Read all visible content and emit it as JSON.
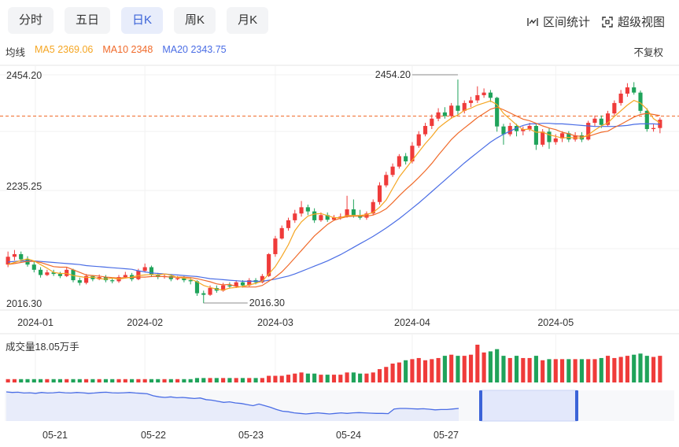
{
  "tabs": [
    {
      "label": "分时",
      "active": false
    },
    {
      "label": "五日",
      "active": false
    },
    {
      "label": "日K",
      "active": true
    },
    {
      "label": "周K",
      "active": false
    },
    {
      "label": "月K",
      "active": false
    }
  ],
  "tools": {
    "interval_stats": "区间统计",
    "super_view": "超级视图"
  },
  "legend": {
    "label": "均线",
    "ma5": "MA5 2369.06",
    "ma10": "MA10 2348",
    "ma20": "MA20 2343.75"
  },
  "rights_label": "不复权",
  "colors": {
    "up": "#ef3b3a",
    "down": "#1fa35a",
    "ma5": "#f5a623",
    "ma10": "#f06a2a",
    "ma20": "#4a6de5",
    "dashed": "#f06a2a",
    "nav_fill": "#e3e8fb",
    "nav_handle": "#3b63d8"
  },
  "chart_data": {
    "type": "candlestick",
    "y_ticks": [
      "2454.20",
      "2235.25",
      "2016.30"
    ],
    "ylim": [
      2016.3,
      2454.2
    ],
    "high_label": "2454.20",
    "low_label": "2016.30",
    "reference_line": 2375,
    "x_ticks": [
      "2024-01",
      "2024-02",
      "2024-03",
      "2024-04",
      "2024-05"
    ],
    "candles": [
      [
        2090,
        2105,
        2115,
        2085
      ],
      [
        2105,
        2110,
        2118,
        2098
      ],
      [
        2110,
        2100,
        2115,
        2095
      ],
      [
        2100,
        2090,
        2106,
        2086
      ],
      [
        2090,
        2080,
        2096,
        2075
      ],
      [
        2080,
        2070,
        2085,
        2065
      ],
      [
        2070,
        2075,
        2080,
        2068
      ],
      [
        2075,
        2072,
        2080,
        2068
      ],
      [
        2072,
        2068,
        2076,
        2064
      ],
      [
        2068,
        2080,
        2085,
        2066
      ],
      [
        2080,
        2060,
        2082,
        2056
      ],
      [
        2060,
        2055,
        2065,
        2050
      ],
      [
        2055,
        2068,
        2072,
        2052
      ],
      [
        2068,
        2062,
        2070,
        2058
      ],
      [
        2062,
        2066,
        2071,
        2060
      ],
      [
        2066,
        2060,
        2070,
        2056
      ],
      [
        2060,
        2058,
        2065,
        2054
      ],
      [
        2058,
        2066,
        2070,
        2055
      ],
      [
        2066,
        2070,
        2076,
        2064
      ],
      [
        2070,
        2062,
        2074,
        2058
      ],
      [
        2062,
        2078,
        2082,
        2060
      ],
      [
        2078,
        2085,
        2092,
        2075
      ],
      [
        2085,
        2070,
        2088,
        2066
      ],
      [
        2070,
        2066,
        2074,
        2062
      ],
      [
        2066,
        2068,
        2072,
        2063
      ],
      [
        2068,
        2062,
        2072,
        2058
      ],
      [
        2062,
        2064,
        2068,
        2060
      ],
      [
        2064,
        2060,
        2068,
        2056
      ],
      [
        2060,
        2058,
        2064,
        2052
      ],
      [
        2058,
        2035,
        2060,
        2030
      ],
      [
        2035,
        2032,
        2040,
        2016
      ],
      [
        2032,
        2045,
        2050,
        2030
      ],
      [
        2045,
        2040,
        2050,
        2036
      ],
      [
        2040,
        2050,
        2055,
        2038
      ],
      [
        2050,
        2048,
        2056,
        2044
      ],
      [
        2048,
        2056,
        2060,
        2045
      ],
      [
        2056,
        2050,
        2060,
        2046
      ],
      [
        2050,
        2060,
        2064,
        2048
      ],
      [
        2060,
        2056,
        2064,
        2052
      ],
      [
        2056,
        2068,
        2072,
        2054
      ],
      [
        2068,
        2110,
        2112,
        2066
      ],
      [
        2110,
        2140,
        2145,
        2105
      ],
      [
        2140,
        2160,
        2165,
        2138
      ],
      [
        2160,
        2175,
        2180,
        2155
      ],
      [
        2175,
        2188,
        2195,
        2170
      ],
      [
        2188,
        2200,
        2212,
        2182
      ],
      [
        2200,
        2192,
        2205,
        2185
      ],
      [
        2192,
        2175,
        2198,
        2170
      ],
      [
        2175,
        2185,
        2190,
        2172
      ],
      [
        2185,
        2176,
        2190,
        2172
      ],
      [
        2176,
        2180,
        2185,
        2174
      ],
      [
        2180,
        2182,
        2188,
        2176
      ],
      [
        2182,
        2196,
        2222,
        2180
      ],
      [
        2196,
        2185,
        2215,
        2180
      ],
      [
        2185,
        2180,
        2195,
        2176
      ],
      [
        2180,
        2188,
        2192,
        2176
      ],
      [
        2188,
        2210,
        2215,
        2185
      ],
      [
        2210,
        2242,
        2248,
        2205
      ],
      [
        2242,
        2262,
        2268,
        2238
      ],
      [
        2262,
        2278,
        2284,
        2258
      ],
      [
        2278,
        2298,
        2302,
        2274
      ],
      [
        2298,
        2288,
        2304,
        2282
      ],
      [
        2288,
        2318,
        2325,
        2284
      ],
      [
        2318,
        2340,
        2346,
        2314
      ],
      [
        2340,
        2356,
        2362,
        2336
      ],
      [
        2356,
        2370,
        2378,
        2350
      ],
      [
        2370,
        2382,
        2390,
        2365
      ],
      [
        2382,
        2375,
        2392,
        2370
      ],
      [
        2375,
        2395,
        2400,
        2370
      ],
      [
        2395,
        2385,
        2445,
        2378
      ],
      [
        2385,
        2400,
        2405,
        2380
      ],
      [
        2400,
        2405,
        2412,
        2392
      ],
      [
        2405,
        2415,
        2432,
        2400
      ],
      [
        2415,
        2420,
        2428,
        2410
      ],
      [
        2420,
        2410,
        2425,
        2402
      ],
      [
        2410,
        2355,
        2412,
        2345
      ],
      [
        2355,
        2340,
        2360,
        2320
      ],
      [
        2340,
        2356,
        2362,
        2336
      ],
      [
        2356,
        2346,
        2360,
        2336
      ],
      [
        2346,
        2350,
        2355,
        2338
      ],
      [
        2350,
        2356,
        2362,
        2346
      ],
      [
        2356,
        2320,
        2360,
        2310
      ],
      [
        2320,
        2345,
        2350,
        2316
      ],
      [
        2345,
        2325,
        2352,
        2312
      ],
      [
        2325,
        2332,
        2340,
        2320
      ],
      [
        2332,
        2342,
        2346,
        2325
      ],
      [
        2342,
        2330,
        2346,
        2325
      ],
      [
        2330,
        2338,
        2344,
        2326
      ],
      [
        2338,
        2330,
        2344,
        2325
      ],
      [
        2330,
        2362,
        2366,
        2328
      ],
      [
        2362,
        2370,
        2376,
        2355
      ],
      [
        2370,
        2358,
        2376,
        2352
      ],
      [
        2358,
        2380,
        2385,
        2355
      ],
      [
        2380,
        2400,
        2405,
        2376
      ],
      [
        2400,
        2418,
        2425,
        2395
      ],
      [
        2418,
        2430,
        2438,
        2412
      ],
      [
        2430,
        2420,
        2440,
        2416
      ],
      [
        2420,
        2385,
        2424,
        2380
      ],
      [
        2385,
        2350,
        2390,
        2345
      ],
      [
        2350,
        2352,
        2360,
        2345
      ],
      [
        2352,
        2368,
        2372,
        2342
      ]
    ],
    "ma5": [
      2090,
      2094,
      2098,
      2101,
      2097,
      2090,
      2083,
      2075,
      2073,
      2073,
      2069,
      2067,
      2065,
      2066,
      2063,
      2062,
      2064,
      2062,
      2064,
      2066,
      2069,
      2070,
      2071,
      2070,
      2072,
      2070,
      2065,
      2064,
      2062,
      2057,
      2050,
      2046,
      2043,
      2041,
      2045,
      2046,
      2048,
      2051,
      2054,
      2058,
      2072,
      2086,
      2106,
      2128,
      2155,
      2172,
      2183,
      2187,
      2188,
      2184,
      2180,
      2180,
      2184,
      2184,
      2184,
      2186,
      2190,
      2200,
      2214,
      2236,
      2258,
      2274,
      2290,
      2306,
      2322,
      2336,
      2352,
      2362,
      2371,
      2377,
      2386,
      2390,
      2396,
      2400,
      2404,
      2397,
      2380,
      2369,
      2358,
      2349,
      2350,
      2344,
      2344,
      2339,
      2336,
      2333,
      2334,
      2333,
      2333,
      2339,
      2348,
      2356,
      2362,
      2374,
      2385,
      2396,
      2405,
      2400,
      2388,
      2370,
      2362
    ],
    "ma10": [
      2090,
      2092,
      2094,
      2096,
      2096,
      2094,
      2090,
      2086,
      2085,
      2085,
      2080,
      2075,
      2070,
      2069,
      2068,
      2066,
      2065,
      2064,
      2065,
      2065,
      2066,
      2066,
      2067,
      2067,
      2067,
      2066,
      2066,
      2066,
      2065,
      2063,
      2060,
      2057,
      2053,
      2051,
      2052,
      2048,
      2047,
      2047,
      2047,
      2050,
      2058,
      2066,
      2076,
      2089,
      2103,
      2117,
      2131,
      2145,
      2156,
      2167,
      2175,
      2179,
      2182,
      2183,
      2183,
      2183,
      2185,
      2190,
      2197,
      2209,
      2222,
      2234,
      2245,
      2257,
      2270,
      2284,
      2300,
      2315,
      2330,
      2342,
      2352,
      2362,
      2372,
      2380,
      2388,
      2392,
      2387,
      2381,
      2375,
      2369,
      2366,
      2361,
      2356,
      2352,
      2349,
      2344,
      2341,
      2337,
      2336,
      2336,
      2340,
      2344,
      2346,
      2353,
      2359,
      2366,
      2373,
      2378,
      2380,
      2378,
      2376
    ],
    "ma20": [
      2095,
      2096,
      2097,
      2097,
      2097,
      2096,
      2095,
      2094,
      2093,
      2092,
      2091,
      2090,
      2088,
      2087,
      2086,
      2085,
      2084,
      2083,
      2082,
      2081,
      2078,
      2076,
      2074,
      2073,
      2072,
      2071,
      2070,
      2069,
      2068,
      2067,
      2065,
      2063,
      2062,
      2061,
      2060,
      2059,
      2058,
      2058,
      2058,
      2058,
      2060,
      2062,
      2065,
      2068,
      2072,
      2077,
      2082,
      2087,
      2092,
      2097,
      2103,
      2109,
      2116,
      2123,
      2130,
      2137,
      2144,
      2152,
      2160,
      2169,
      2178,
      2188,
      2198,
      2208,
      2219,
      2230,
      2241,
      2252,
      2263,
      2274,
      2285,
      2295,
      2305,
      2315,
      2325,
      2333,
      2340,
      2346,
      2352,
      2357,
      2360,
      2360,
      2361,
      2361,
      2360,
      2360,
      2359,
      2358,
      2357,
      2356,
      2355,
      2355,
      2355,
      2355,
      2356,
      2357,
      2359,
      2360,
      2360,
      2360,
      2359
    ],
    "volume_label": "成交量18.05万手",
    "volume": [
      3,
      3,
      3,
      3,
      3,
      3,
      3,
      3,
      3,
      3,
      3,
      3,
      3,
      3,
      3,
      3,
      3,
      3,
      3,
      3,
      3,
      3,
      3,
      3,
      3,
      3,
      3,
      3,
      3,
      4,
      4,
      4,
      4,
      4,
      4,
      4,
      4,
      4,
      4,
      4,
      6,
      6,
      6,
      7,
      8,
      9,
      8,
      8,
      7,
      7,
      7,
      7,
      9,
      9,
      8,
      8,
      9,
      12,
      14,
      17,
      18,
      20,
      21,
      22,
      20,
      21,
      22,
      24,
      25,
      24,
      24,
      25,
      34,
      27,
      28,
      30,
      24,
      22,
      24,
      22,
      22,
      24,
      20,
      21,
      21,
      21,
      21,
      21,
      21,
      21,
      21,
      22,
      24,
      22,
      23,
      24,
      25,
      26,
      24,
      23,
      24
    ],
    "navigator": {
      "x_ticks": [
        "05-21",
        "05-22",
        "05-23",
        "05-24",
        "05-27"
      ],
      "series": [
        1.0,
        0.98,
        0.99,
        0.96,
        0.97,
        0.95,
        0.98,
        0.96,
        0.97,
        0.99,
        0.97,
        0.96,
        0.98,
        0.97,
        0.95,
        0.96,
        0.98,
        0.99,
        0.97,
        0.96,
        0.97,
        0.98,
        0.96,
        0.95,
        0.93,
        0.86,
        0.82,
        0.8,
        0.82,
        0.79,
        0.8,
        0.78,
        0.76,
        0.78,
        0.72,
        0.7,
        0.66,
        0.62,
        0.64,
        0.6,
        0.58,
        0.54,
        0.5,
        0.56,
        0.5,
        0.44,
        0.36,
        0.3,
        0.28,
        0.24,
        0.22,
        0.2,
        0.22,
        0.24,
        0.22,
        0.2,
        0.22,
        0.24,
        0.22,
        0.24,
        0.25,
        0.24,
        0.23,
        0.22,
        0.22,
        0.21,
        0.38,
        0.4,
        0.4,
        0.39,
        0.38,
        0.39,
        0.37,
        0.35,
        0.36,
        0.36,
        0.38,
        0.4
      ]
    }
  }
}
